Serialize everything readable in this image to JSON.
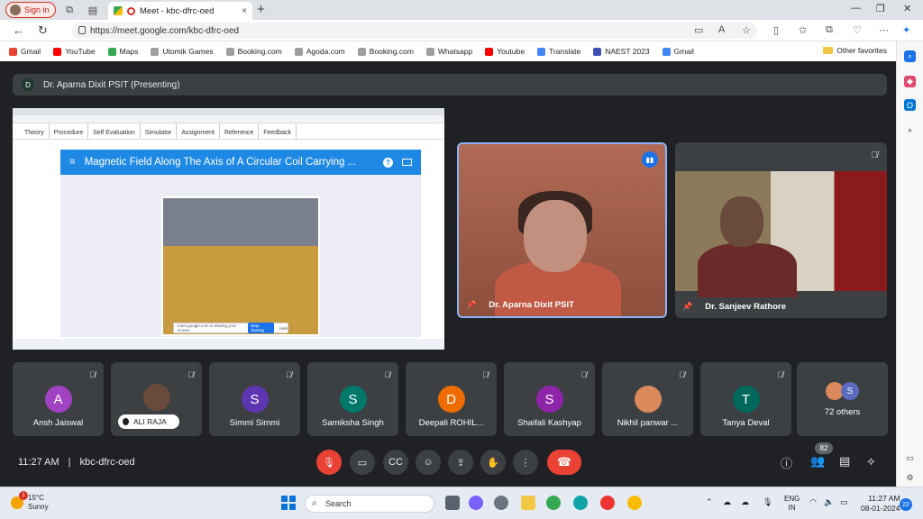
{
  "browser": {
    "signin_label": "Sign in",
    "tab_title": "Meet - kbc-dfrc-oed",
    "tab_close": "×",
    "new_tab": "+",
    "url": "https://meet.google.com/kbc-dfrc-oed",
    "window_controls": {
      "minimize": "—",
      "maximize": "❐",
      "close": "✕"
    },
    "bookmarks": [
      {
        "label": "Gmail",
        "color": "#ea4335"
      },
      {
        "label": "YouTube",
        "color": "#ff0000"
      },
      {
        "label": "Maps",
        "color": "#34a853"
      },
      {
        "label": "Utomik Games",
        "color": "#9e9e9e"
      },
      {
        "label": "Booking.com",
        "color": "#9e9e9e"
      },
      {
        "label": "Agoda.com",
        "color": "#9e9e9e"
      },
      {
        "label": "Booking.com",
        "color": "#9e9e9e"
      },
      {
        "label": "Whatsapp",
        "color": "#9e9e9e"
      },
      {
        "label": "Youtube",
        "color": "#ff0000"
      },
      {
        "label": "Translate",
        "color": "#4285f4"
      },
      {
        "label": "NAEST 2023",
        "color": "#3f51b5"
      },
      {
        "label": "Gmail",
        "color": "#4285f4"
      }
    ],
    "other_favorites": "Other favorites"
  },
  "meet": {
    "presenter_initial": "D",
    "presenter_banner": "Dr. Aparna Dixit PSIT (Presenting)",
    "shared_screen": {
      "menu": [
        "Theory",
        "Procedure",
        "Self Evaluation",
        "Simulator",
        "Assignment",
        "Reference",
        "Feedback"
      ],
      "lab_title": "Magnetic Field Along The Axis of A Circular Coil Carrying ...",
      "help_icon": "?",
      "sharing_notice": "meet.google.com is sharing your screen.",
      "stop_sharing": "Stop sharing",
      "hide": "Hide"
    },
    "main_tiles": [
      {
        "name": "Dr. Aparna Dixit PSIT"
      },
      {
        "name": "Dr. Sanjeev Rathore"
      }
    ],
    "participants": [
      {
        "initial": "A",
        "name": "Ansh Jaiswal",
        "color": "#a142c2"
      },
      {
        "initial": "",
        "name": "ALI RAJA",
        "color": "#6a4a3a"
      },
      {
        "initial": "S",
        "name": "Simmi Simmi",
        "color": "#5e35b1"
      },
      {
        "initial": "S",
        "name": "Samiksha Singh",
        "color": "#00796b"
      },
      {
        "initial": "D",
        "name": "Deepali ROHIL...",
        "color": "#ef6c00"
      },
      {
        "initial": "S",
        "name": "Shaifali Kashyap",
        "color": "#8e24aa"
      },
      {
        "initial": "",
        "name": "Nikhil panwar ...",
        "color": "#d9895b"
      },
      {
        "initial": "T",
        "name": "Tanya Deval",
        "color": "#00695c"
      }
    ],
    "others": {
      "initial": "S",
      "label": "72 others"
    },
    "time": "11:27 AM",
    "meeting_code": "kbc-dfrc-oed",
    "people_count": "82"
  },
  "taskbar": {
    "temperature": "15°C",
    "weather": "Sunny",
    "weather_badge": "1",
    "search_label": "Search",
    "lang_top": "ENG",
    "lang_bottom": "IN",
    "time": "11:27 AM",
    "date": "08-01-2024",
    "notif_count": "22"
  }
}
